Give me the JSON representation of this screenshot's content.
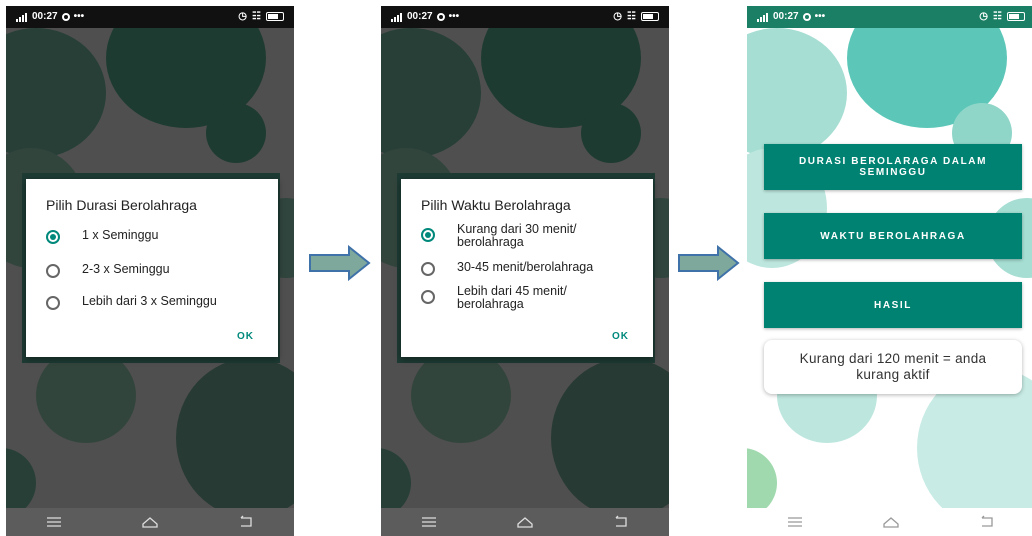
{
  "status_time": "00:27",
  "status_extra": "•••",
  "screen1": {
    "dialog_title": "Pilih Durasi Berolahraga",
    "options": [
      {
        "label": "1 x Seminggu",
        "selected": true
      },
      {
        "label": "2-3 x Seminggu",
        "selected": false
      },
      {
        "label": "Lebih dari 3 x Seminggu",
        "selected": false
      }
    ],
    "ok": "OK"
  },
  "screen2": {
    "dialog_title": "Pilih Waktu Berolahraga",
    "options": [
      {
        "label": "Kurang dari 30 menit/ berolahraga",
        "selected": true
      },
      {
        "label": "30-45 menit/berolahraga",
        "selected": false
      },
      {
        "label": "Lebih dari 45 menit/ berolahraga",
        "selected": false
      }
    ],
    "ok": "OK"
  },
  "screen3": {
    "btn_durasi": "DURASI BEROLARAGA DALAM SEMINGGU",
    "btn_waktu": "WAKTU BEROLAHRAGA",
    "btn_hasil": "HASIL",
    "result_text": "Kurang dari 120 menit = anda kurang aktif"
  },
  "colors": {
    "accent": "#00897b",
    "button": "#008272",
    "statusbar_green": "#1a7f64",
    "arrow": "#4a8aa0"
  },
  "icons": [
    "signal-icon",
    "sync-icon",
    "alarm-icon",
    "wifi-icon",
    "battery-icon",
    "menu-icon",
    "home-icon",
    "back-icon",
    "arrow-right-icon"
  ]
}
